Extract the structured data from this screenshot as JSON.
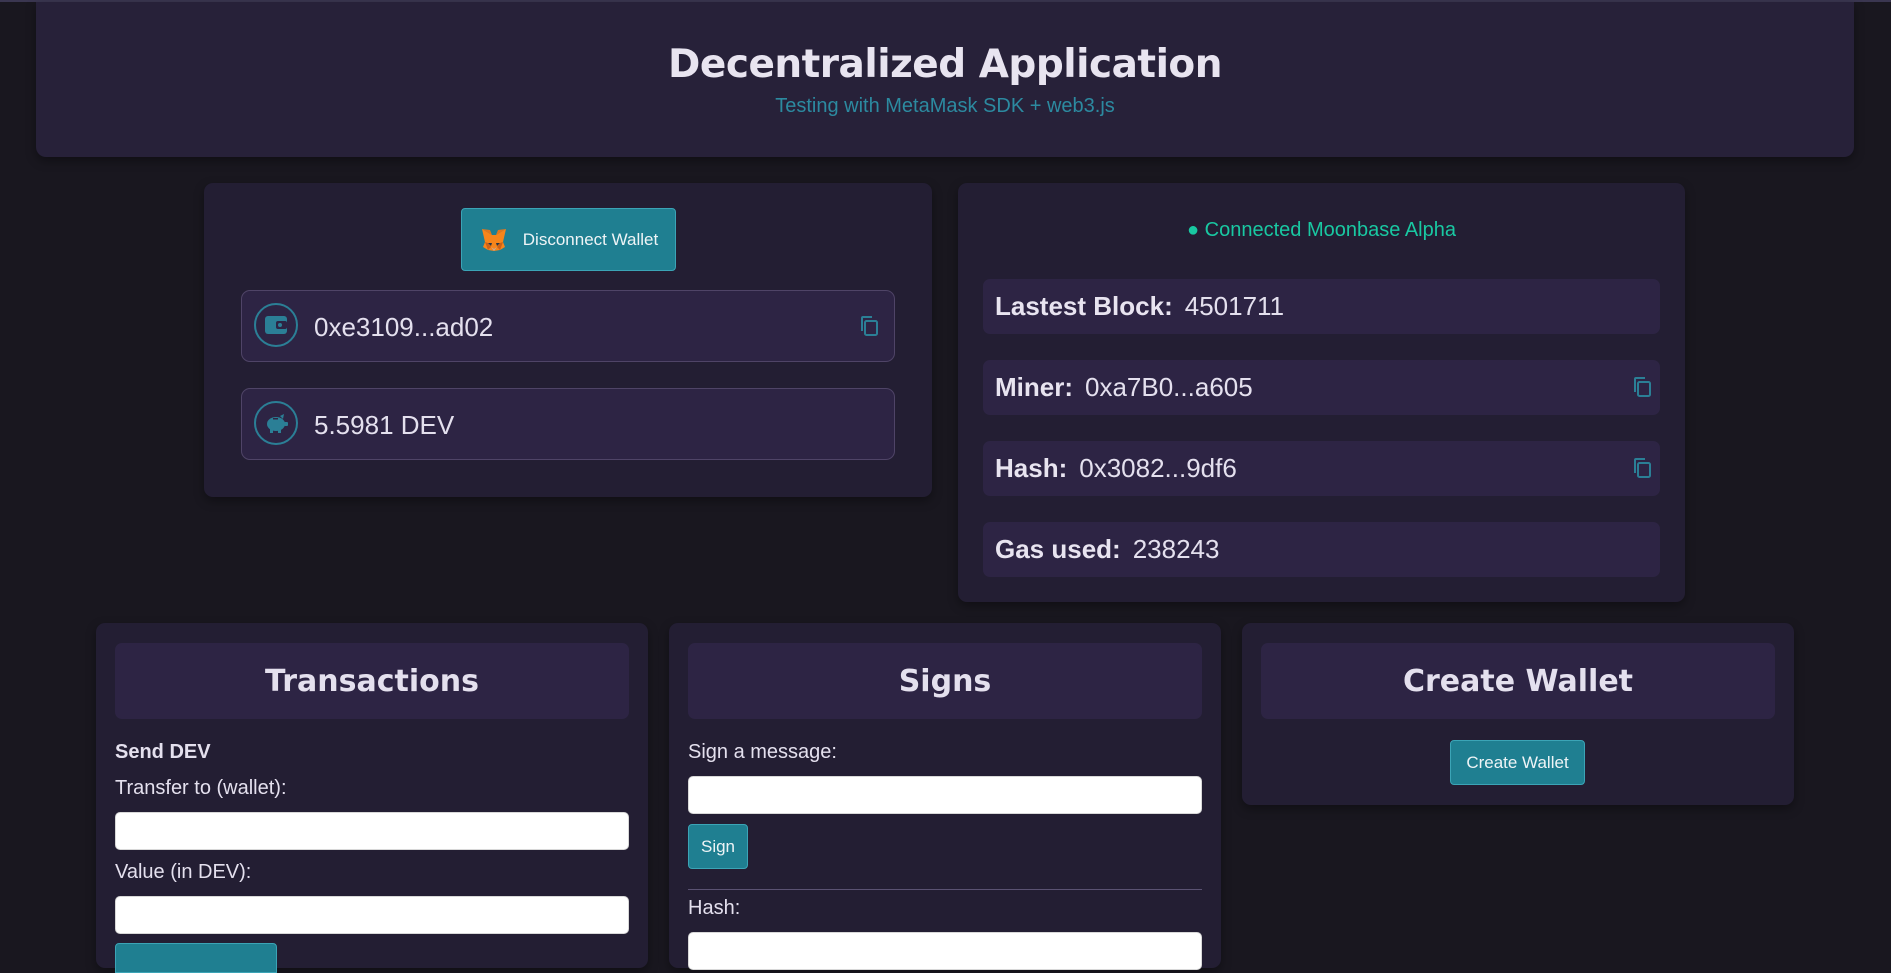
{
  "header": {
    "title": "Decentralized Application",
    "subtitle": "Testing with MetaMask SDK + web3.js"
  },
  "wallet": {
    "disconnect_label": "Disconnect Wallet",
    "address": "0xe3109...ad02",
    "balance": "5.5981 DEV"
  },
  "network": {
    "status": "● Connected Moonbase Alpha",
    "rows": [
      {
        "label": "Lastest Block:",
        "value": "4501711"
      },
      {
        "label": "Miner:",
        "value": "0xa7B0...a605"
      },
      {
        "label": "Hash:",
        "value": "0x3082...9df6"
      },
      {
        "label": "Gas used:",
        "value": "238243"
      }
    ]
  },
  "transactions": {
    "title": "Transactions",
    "section": "Send DEV",
    "to_label": "Transfer to (wallet):",
    "to_value": "",
    "value_label": "Value (in DEV):",
    "value_value": ""
  },
  "signs": {
    "title": "Signs",
    "message_label": "Sign a message:",
    "message_value": "",
    "sign_button": "Sign",
    "hash_label": "Hash:",
    "hash_value": ""
  },
  "create_wallet": {
    "title": "Create Wallet",
    "button": "Create Wallet"
  },
  "colors": {
    "background": "#19171f",
    "panel": "#231e33",
    "row": "#2d2444",
    "accent": "#1f7f91",
    "status_green": "#19c8a2",
    "subtitle_teal": "#2c8aa0"
  }
}
